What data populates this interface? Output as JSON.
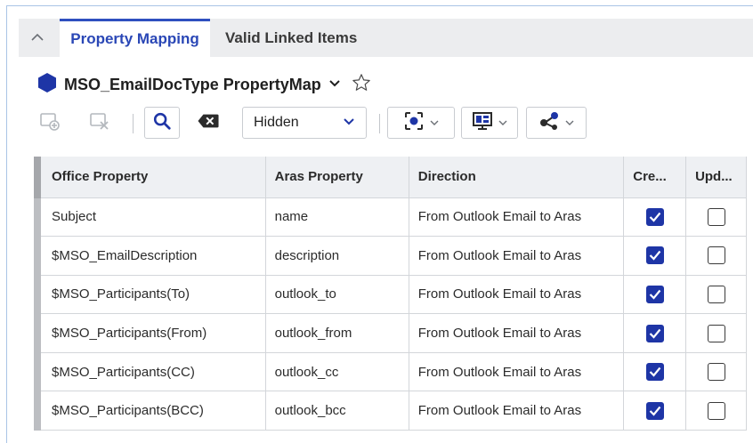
{
  "tabs": [
    {
      "label": "Property Mapping",
      "active": true
    },
    {
      "label": "Valid Linked Items",
      "active": false
    }
  ],
  "item": {
    "title": "MSO_EmailDocType PropertyMap",
    "icon": "hexagon-icon",
    "accent": "#1e35a6"
  },
  "toolbar": {
    "filter_select_value": "Hidden"
  },
  "table": {
    "columns": [
      "Office Property",
      "Aras Property",
      "Direction",
      "Cre...",
      "Upd..."
    ],
    "rows": [
      {
        "office": "Subject",
        "aras": "name",
        "direction": "From Outlook Email to Aras",
        "create": true,
        "update": false
      },
      {
        "office": "$MSO_EmailDescription",
        "aras": "description",
        "direction": "From Outlook Email to Aras",
        "create": true,
        "update": false
      },
      {
        "office": "$MSO_Participants(To)",
        "aras": "outlook_to",
        "direction": "From Outlook Email to Aras",
        "create": true,
        "update": false
      },
      {
        "office": "$MSO_Participants(From)",
        "aras": "outlook_from",
        "direction": "From Outlook Email to Aras",
        "create": true,
        "update": false
      },
      {
        "office": "$MSO_Participants(CC)",
        "aras": "outlook_cc",
        "direction": "From Outlook Email to Aras",
        "create": true,
        "update": false
      },
      {
        "office": "$MSO_Participants(BCC)",
        "aras": "outlook_bcc",
        "direction": "From Outlook Email to Aras",
        "create": true,
        "update": false
      }
    ]
  }
}
